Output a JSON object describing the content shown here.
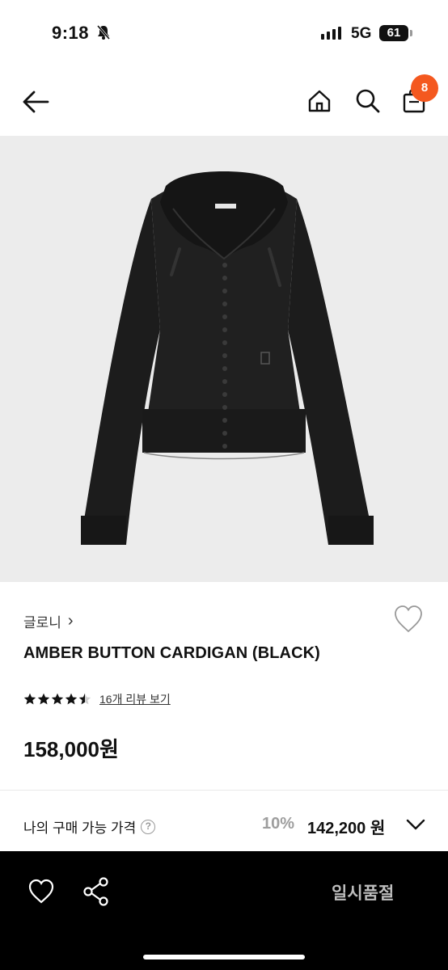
{
  "status": {
    "time": "9:18",
    "network": "5G",
    "battery": "61"
  },
  "nav": {
    "cart_count": "8",
    "icons": [
      "back-arrow-icon",
      "home-icon",
      "search-icon",
      "cart-bag-icon"
    ]
  },
  "product": {
    "brand": "글로니",
    "brand_chevron": "›",
    "title": "AMBER BUTTON CARDIGAN (BLACK)",
    "rating": 4.5,
    "review_link": "16개 리뷰 보기",
    "price": "158,000원"
  },
  "purchase": {
    "label": "나의 구매 가능 가격",
    "help": "?",
    "discount": "10%",
    "sale_price": "142,200 원"
  },
  "bottom": {
    "soldout_label": "일시품절"
  },
  "colors": {
    "badge": "#f4581f",
    "hero_bg": "#ececec",
    "bottom_bar": "#000000",
    "soldout_text": "#bdbdbd"
  }
}
